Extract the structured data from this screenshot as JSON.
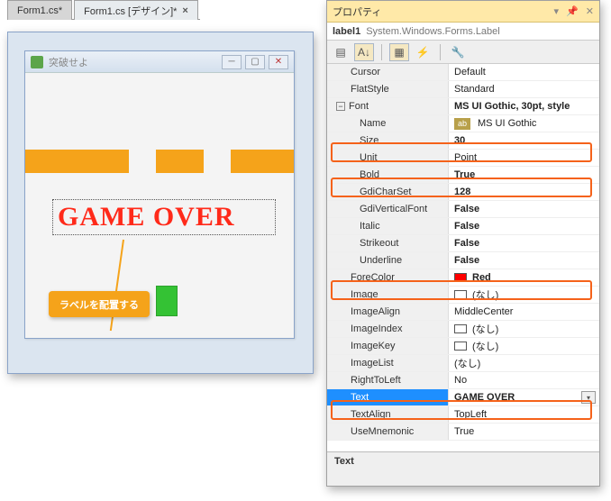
{
  "tabs": {
    "inactive": "Form1.cs*",
    "active": "Form1.cs [デザイン]*"
  },
  "form": {
    "title": "突破せよ",
    "gameOverText": "GAME OVER"
  },
  "callout": {
    "text": "ラベルを配置する"
  },
  "properties": {
    "panelTitle": "プロパティ",
    "objectName": "label1",
    "objectType": "System.Windows.Forms.Label",
    "rows": {
      "cursor": {
        "label": "Cursor",
        "value": "Default"
      },
      "flatStyle": {
        "label": "FlatStyle",
        "value": "Standard"
      },
      "font": {
        "label": "Font",
        "value": "MS UI Gothic, 30pt, style"
      },
      "fontName": {
        "label": "Name",
        "value": "MS UI Gothic"
      },
      "fontSize": {
        "label": "Size",
        "value": "30"
      },
      "fontUnit": {
        "label": "Unit",
        "value": "Point"
      },
      "fontBold": {
        "label": "Bold",
        "value": "True"
      },
      "fontGdiCS": {
        "label": "GdiCharSet",
        "value": "128"
      },
      "fontGdiVF": {
        "label": "GdiVerticalFont",
        "value": "False"
      },
      "fontItalic": {
        "label": "Italic",
        "value": "False"
      },
      "fontStrike": {
        "label": "Strikeout",
        "value": "False"
      },
      "fontUnder": {
        "label": "Underline",
        "value": "False"
      },
      "foreColor": {
        "label": "ForeColor",
        "value": "Red"
      },
      "image": {
        "label": "Image",
        "value": "(なし)"
      },
      "imageAlign": {
        "label": "ImageAlign",
        "value": "MiddleCenter"
      },
      "imageIndex": {
        "label": "ImageIndex",
        "value": "(なし)"
      },
      "imageKey": {
        "label": "ImageKey",
        "value": "(なし)"
      },
      "imageList": {
        "label": "ImageList",
        "value": "(なし)"
      },
      "rightToLeft": {
        "label": "RightToLeft",
        "value": "No"
      },
      "text": {
        "label": "Text",
        "value": "GAME OVER"
      },
      "textAlign": {
        "label": "TextAlign",
        "value": "TopLeft"
      },
      "useMnemonic": {
        "label": "UseMnemonic",
        "value": "True"
      }
    },
    "descriptionHeader": "Text"
  }
}
